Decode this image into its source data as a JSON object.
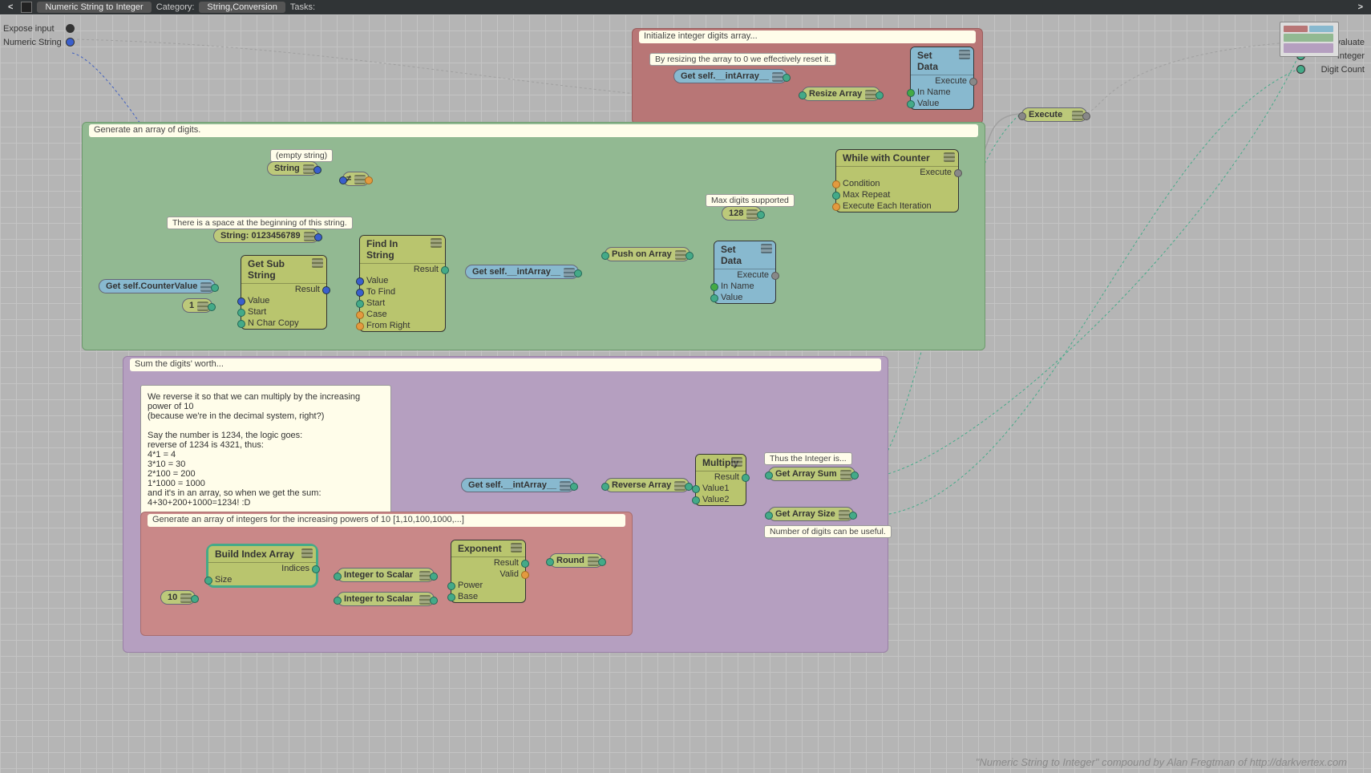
{
  "header": {
    "title": "Numeric String to Integer",
    "category_label": "Category:",
    "category_value": "String,Conversion",
    "tasks_label": "Tasks:"
  },
  "left_ports": {
    "expose_input": "Expose input",
    "numeric_string": "Numeric String"
  },
  "right_ports": {
    "evaluate": "Evaluate",
    "integer": "Integer",
    "digit_count": "Digit Count"
  },
  "attribution": "\"Numeric String to Integer\" compound by Alan Fregtman of http://darkvertex.com",
  "groups": {
    "init": {
      "title": "Initialize integer digits array..."
    },
    "generate": {
      "title": "Generate an array of digits."
    },
    "sum": {
      "title": "Sum the digits' worth..."
    },
    "powers": {
      "title": "Generate an array of integers for the increasing powers of 10  [1,10,100,1000,...]"
    }
  },
  "comments": {
    "tip_reset": "By resizing the array to 0 we effectively reset it.",
    "empty_string": "(empty string)",
    "space_tip": "There is a space at the beginning of this string.",
    "max_digits": "Max digits supported",
    "thus_integer": "Thus the Integer is...",
    "digits_useful": "Number of digits can be useful.",
    "reverse_explain": "We reverse it so that we can multiply by the increasing power of 10\n(because we're in the decimal system, right?)\n\nSay the number is 1234, the logic goes:\nreverse of 1234 is 4321, thus:\n4*1 = 4\n3*10 = 30\n2*100 = 200\n1*1000 = 1000\nand it's in an array, so when we get the sum:\n4+30+200+1000=1234! :D"
  },
  "nodes": {
    "set_data_top": {
      "title": "Set Data",
      "ports": {
        "execute": "Execute",
        "in_name": "In Name",
        "value": "Value"
      }
    },
    "get_intarray_top": {
      "title": "Get self.__intArray__"
    },
    "resize_array": {
      "title": "Resize Array"
    },
    "string": {
      "title": "String"
    },
    "neq": {
      "title": "≠"
    },
    "string_digits": {
      "title": "String: 0123456789"
    },
    "get_substring": {
      "title": "Get Sub String",
      "ports": {
        "result": "Result",
        "value": "Value",
        "start": "Start",
        "nchar": "N Char Copy"
      }
    },
    "get_counter": {
      "title": "Get self.CounterValue"
    },
    "one": {
      "title": "1"
    },
    "find_in_string": {
      "title": "Find In String",
      "ports": {
        "result": "Result",
        "value": "Value",
        "tofind": "To Find",
        "start": "Start",
        "case": "Case",
        "fromright": "From Right"
      }
    },
    "get_intarray_mid": {
      "title": "Get self.__intArray__"
    },
    "push_on_array": {
      "title": "Push on Array"
    },
    "set_data_mid": {
      "title": "Set Data",
      "ports": {
        "execute": "Execute",
        "in_name": "In Name",
        "value": "Value"
      }
    },
    "max128": {
      "title": "128"
    },
    "while_counter": {
      "title": "While with Counter",
      "ports": {
        "execute": "Execute",
        "condition": "Condition",
        "maxrepeat": "Max Repeat",
        "each": "Execute Each Iteration"
      }
    },
    "execute": {
      "title": "Execute"
    },
    "get_intarray_sum": {
      "title": "Get self.__intArray__"
    },
    "reverse_array": {
      "title": "Reverse Array"
    },
    "multiply": {
      "title": "Multiply",
      "ports": {
        "result": "Result",
        "value1": "Value1",
        "value2": "Value2"
      }
    },
    "get_array_sum": {
      "title": "Get Array Sum"
    },
    "get_array_size": {
      "title": "Get Array Size"
    },
    "ten": {
      "title": "10"
    },
    "build_index": {
      "title": "Build Index Array",
      "ports": {
        "indices": "Indices",
        "size": "Size"
      }
    },
    "int_to_scalar_1": {
      "title": "Integer to Scalar"
    },
    "int_to_scalar_2": {
      "title": "Integer to Scalar"
    },
    "exponent": {
      "title": "Exponent",
      "ports": {
        "result": "Result",
        "valid": "Valid",
        "power": "Power",
        "base": "Base"
      }
    },
    "round": {
      "title": "Round"
    }
  }
}
